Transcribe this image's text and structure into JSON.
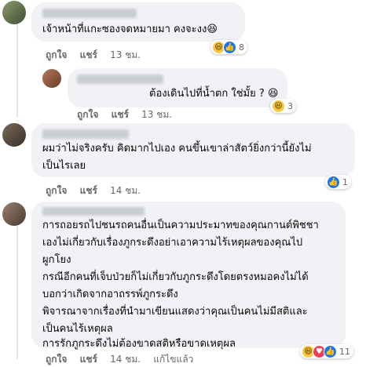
{
  "comments": [
    {
      "text": "เจ้าหน้าที่แกะซองจดหมายมา คงจะงง😆",
      "reactions": {
        "icons": [
          "haha",
          "like"
        ],
        "count": "8"
      },
      "actions": {
        "like": "ถูกใจ",
        "reply": "แชร์",
        "time": "13 ชม."
      }
    },
    {
      "text": "ต้องเดินไปที่น้ำตก ใช่มั้ย ? 😆",
      "reactions": {
        "icons": [
          "haha"
        ],
        "count": "3"
      },
      "actions": {
        "like": "ถูกใจ",
        "reply": "แชร์",
        "time": "13 ชม."
      }
    },
    {
      "lines": [
        "ผมว่าไม่จริงครับ คิดมากไปเอง คนขึ้นเขาล่าสัตว์ยิ่งกว่านี้ยังไม่",
        "เป็นไรเลย"
      ],
      "reactions": {
        "icons": [
          "like"
        ],
        "count": "1"
      },
      "actions": {
        "like": "ถูกใจ",
        "reply": "แชร์",
        "time": "14 ชม."
      }
    },
    {
      "lines": [
        "การถอยรถไปชนรถคนอื่นเป็นความประมาทของคุณกานต์พิชชา",
        "เองไม่เกี่ยวกับเรื่องภูกระดึงอย่าเอาความไร้เหตุผลของคุณไป",
        "ผูกโยง",
        "กรณีอีกคนที่เจ็บป่วยก็ไม่เกี่ยวกับภูกระดึงโดยตรงหมอคงไม่ได้",
        "บอกว่าเกิดจากอาถรรพ์ภูกระดึง",
        "พิจารณาจากเรื่องที่นำมาเขียนแสดงว่าคุณเป็นคนไม่มีสติและ",
        "เป็นคนไร้เหตุผล",
        "การรักภูกระดึงไม่ต้องขาดสติหรือขาดเหตุผล"
      ],
      "reactions": {
        "icons": [
          "haha",
          "love",
          "like"
        ],
        "count": "11"
      },
      "actions": {
        "like": "ถูกใจ",
        "reply": "แชร์",
        "time": "14 ชม.",
        "edited": "แก้ไขแล้ว"
      }
    }
  ]
}
